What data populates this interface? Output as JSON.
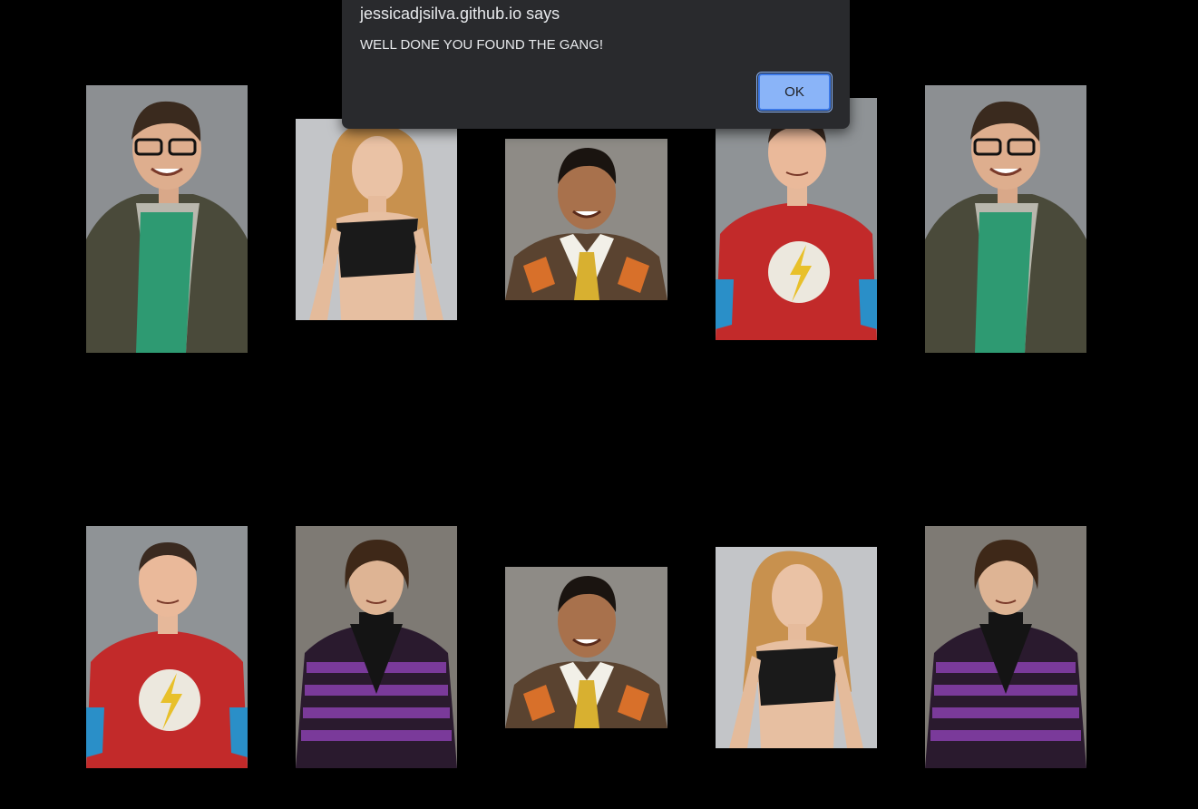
{
  "dialog": {
    "title": "jessicadjsilva.github.io says",
    "message": "WELL DONE YOU FOUND THE GANG!",
    "ok_label": "OK"
  },
  "cards": [
    {
      "character": "leonard",
      "row": 1,
      "col": 1
    },
    {
      "character": "penny",
      "row": 1,
      "col": 2
    },
    {
      "character": "raj",
      "row": 1,
      "col": 3
    },
    {
      "character": "sheldon",
      "row": 1,
      "col": 4
    },
    {
      "character": "leonard",
      "row": 1,
      "col": 5
    },
    {
      "character": "sheldon",
      "row": 2,
      "col": 1
    },
    {
      "character": "howard",
      "row": 2,
      "col": 2
    },
    {
      "character": "raj",
      "row": 2,
      "col": 3
    },
    {
      "character": "penny",
      "row": 2,
      "col": 4
    },
    {
      "character": "howard",
      "row": 2,
      "col": 5
    }
  ],
  "colors": {
    "background": "#000000",
    "dialog_bg": "#292a2d",
    "ok_button": "#8ab4f8"
  }
}
